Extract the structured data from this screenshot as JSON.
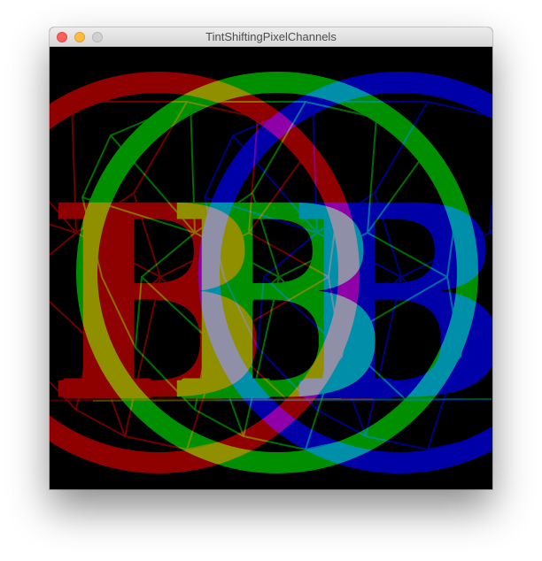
{
  "window": {
    "title": "TintShiftingPixelChannels"
  },
  "controls": {
    "close_color": "#fc605c",
    "minimize_color": "#fdbc40",
    "zoom_color": "#d0d0d0"
  },
  "canvas": {
    "background": "#000000",
    "letter": "B",
    "channels": [
      {
        "name": "red",
        "color": "#8f0000"
      },
      {
        "name": "green",
        "color": "#008f00"
      },
      {
        "name": "blue",
        "color": "#0000a8"
      }
    ]
  }
}
